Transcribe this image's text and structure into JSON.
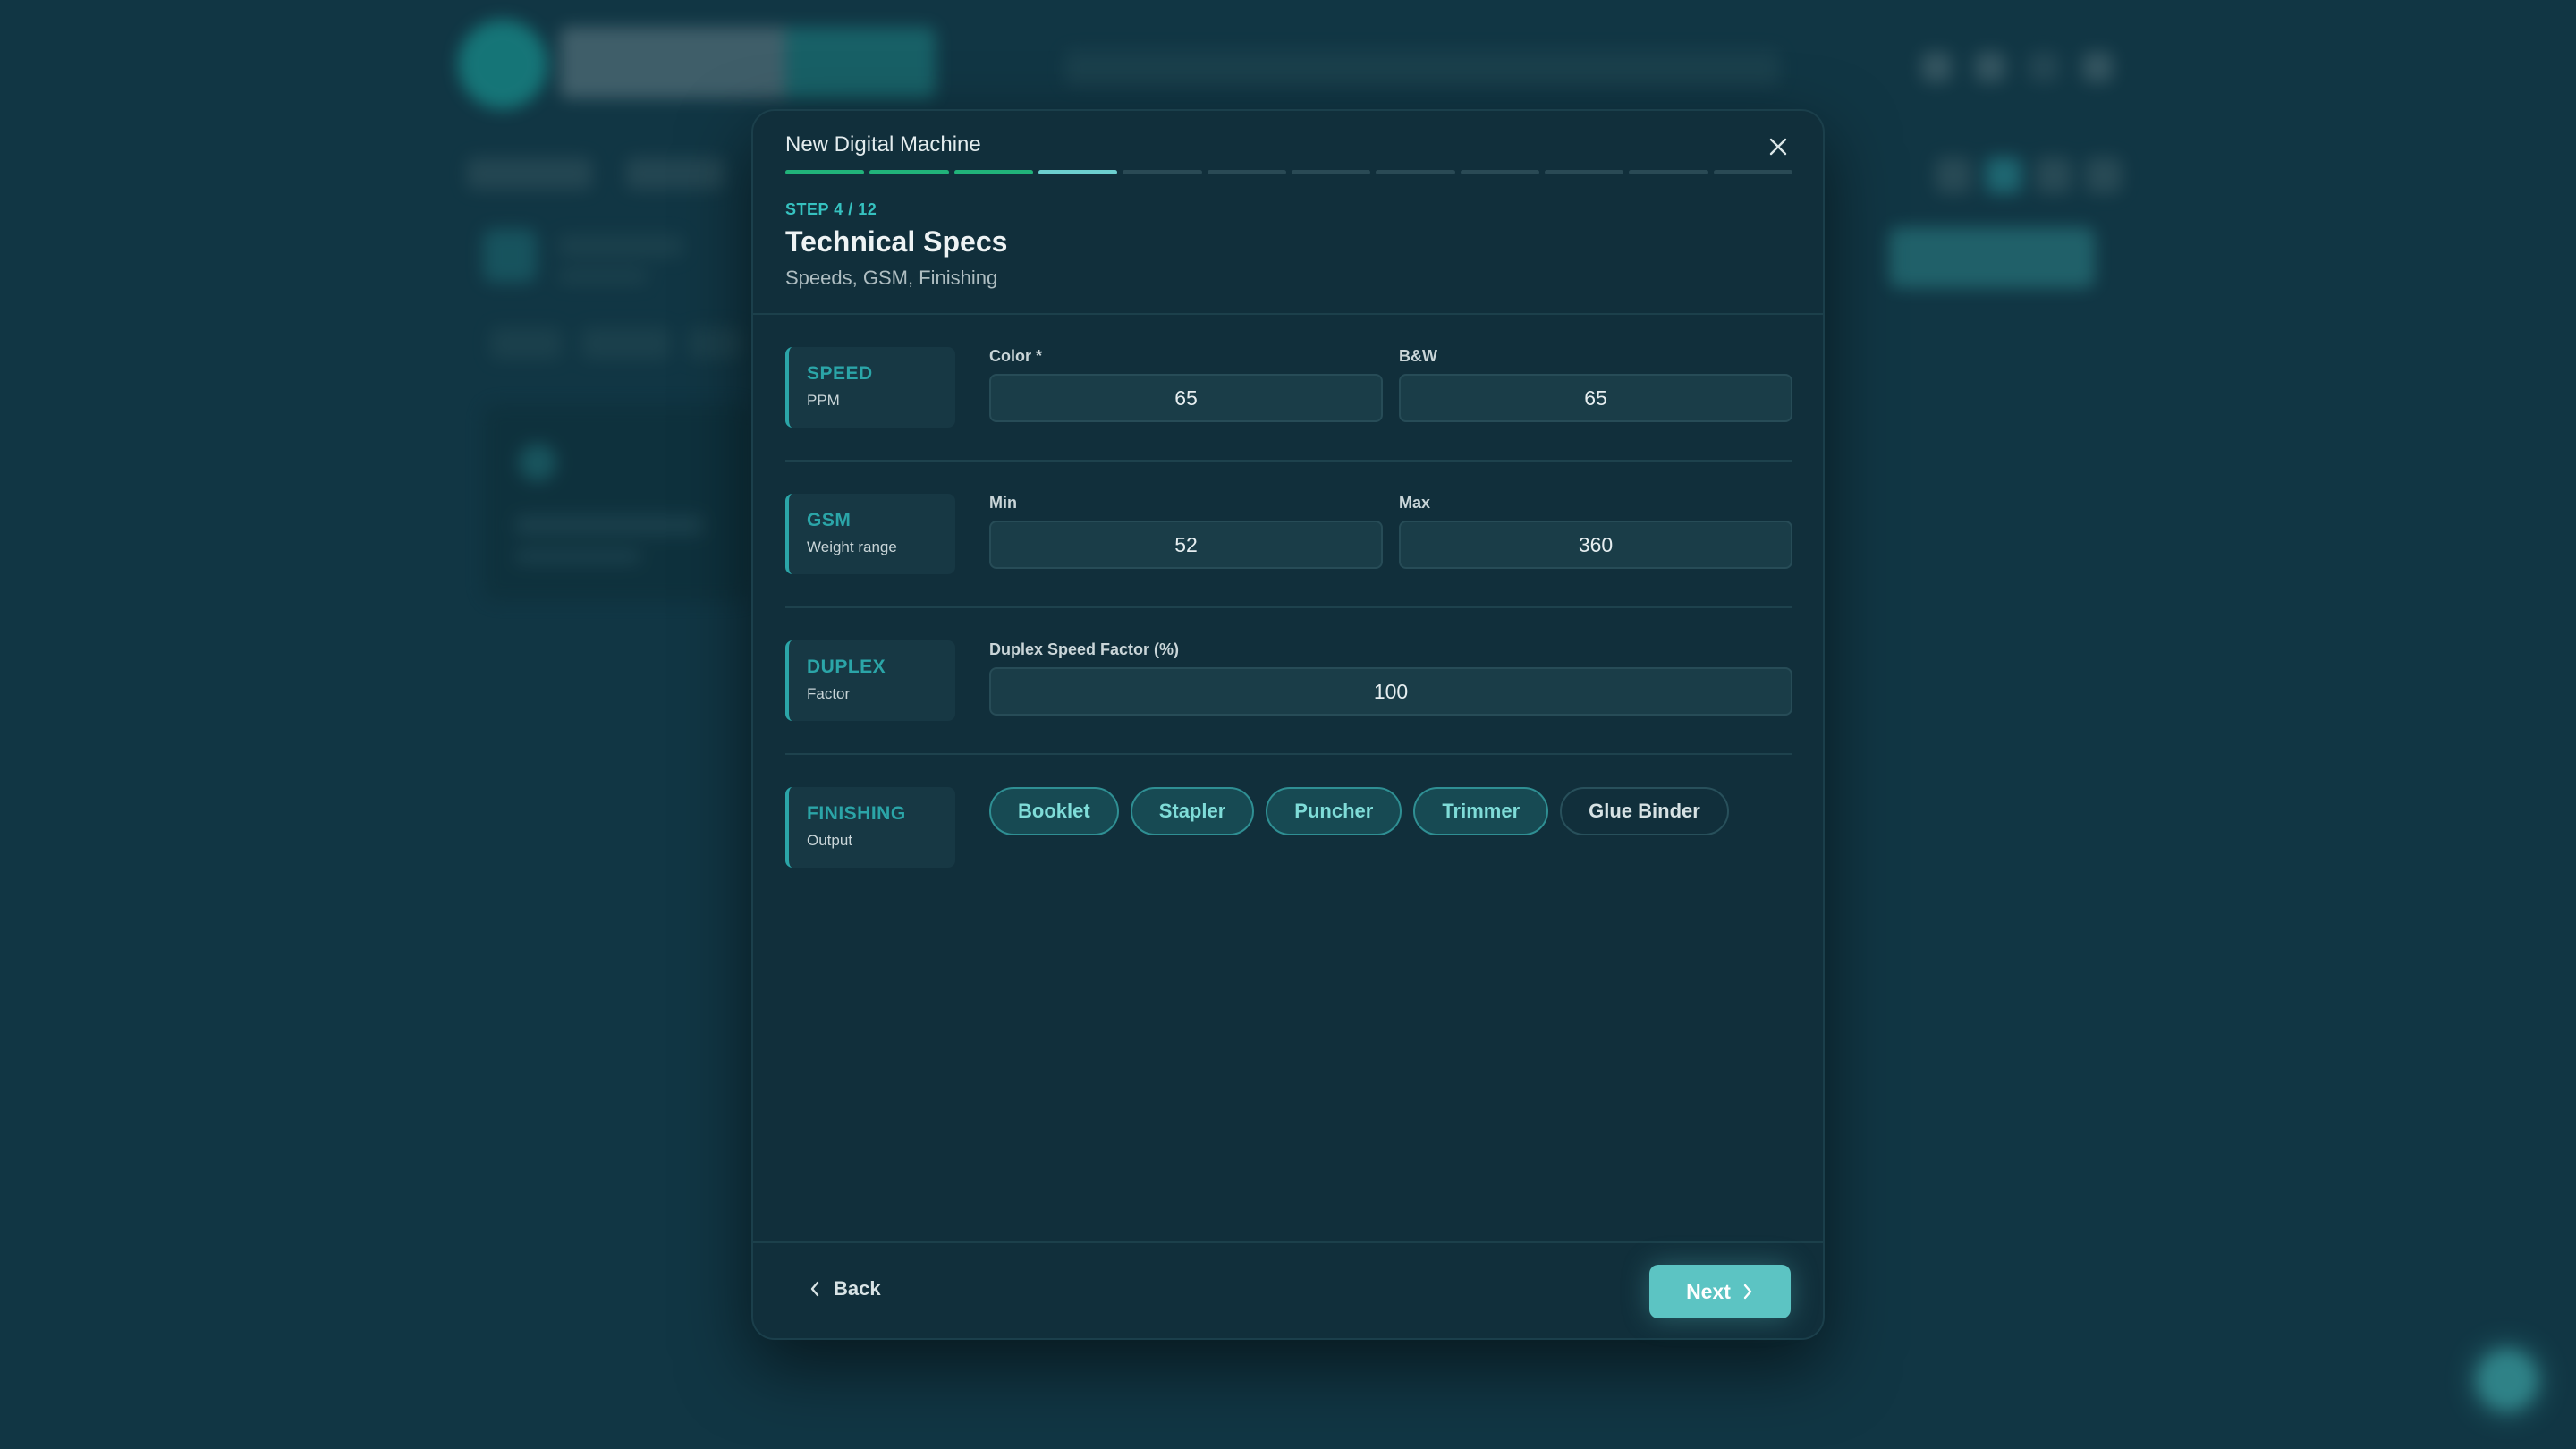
{
  "modal": {
    "title": "New Digital Machine",
    "step_total": 12,
    "step_current": 4,
    "step_label": "STEP 4 / 12",
    "heading": "Technical Specs",
    "subheading": "Speeds, GSM, Finishing"
  },
  "sections": {
    "speed": {
      "name": "SPEED",
      "hint": "PPM",
      "color_label": "Color *",
      "color_value": "65",
      "bw_label": "B&W",
      "bw_value": "65"
    },
    "gsm": {
      "name": "GSM",
      "hint": "Weight range",
      "min_label": "Min",
      "min_value": "52",
      "max_label": "Max",
      "max_value": "360"
    },
    "duplex": {
      "name": "DUPLEX",
      "hint": "Factor",
      "factor_label": "Duplex Speed Factor (%)",
      "factor_value": "100"
    },
    "finishing": {
      "name": "FINISHING",
      "hint": "Output",
      "options": [
        {
          "label": "Booklet",
          "selected": true
        },
        {
          "label": "Stapler",
          "selected": true
        },
        {
          "label": "Puncher",
          "selected": true
        },
        {
          "label": "Trimmer",
          "selected": true
        },
        {
          "label": "Glue Binder",
          "selected": false
        }
      ]
    }
  },
  "footer": {
    "back_label": "Back",
    "next_label": "Next"
  },
  "colors": {
    "accent": "#5cc4c3",
    "progress_done": "#21b37a",
    "progress_current": "#6ccfcf",
    "section_accent": "#2ba5a8"
  }
}
